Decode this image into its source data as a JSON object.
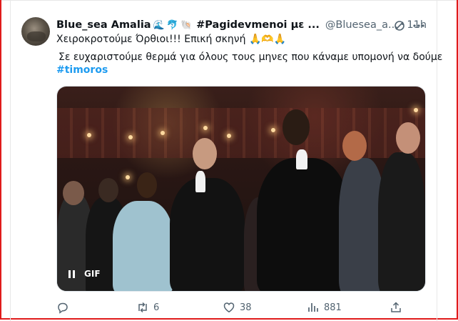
{
  "tweet": {
    "display_name": "Blue_sea Amalia",
    "name_emojis": [
      "🌊",
      "🐬",
      "🐚"
    ],
    "hashtag_name": "#Pagidevmenoi με ...",
    "handle": "@Bluesea_a...",
    "separator": "·",
    "time": "11h",
    "text_line1": "Χειροκροτούμε Όρθιοι!!! Επική σκηνή 🙏🫶🙏",
    "text_line2": "Σε ευχαριστούμε θερμά για όλους τους μηνες που κάναμε υπομονή να δούμε",
    "hashtag": "#timoros",
    "media": {
      "type_label": "GIF"
    },
    "actions": {
      "replies": "",
      "retweets": "6",
      "likes": "38",
      "views": "881"
    }
  },
  "icons": {
    "grok": "grok-icon",
    "more": "more-icon",
    "reply": "reply-icon",
    "retweet": "retweet-icon",
    "like": "heart-icon",
    "views": "views-icon",
    "share": "share-icon",
    "pause": "pause-icon"
  },
  "colors": {
    "link": "#1d9bf0",
    "muted": "#536471",
    "frame": "#e01b1b"
  }
}
